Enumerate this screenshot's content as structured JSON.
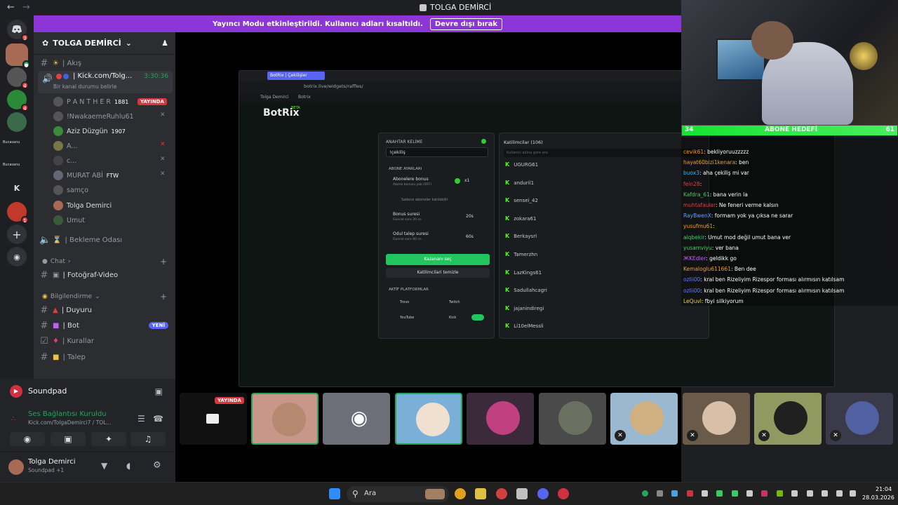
{
  "window": {
    "title": "TOLGA DEMİRCİ"
  },
  "banner": {
    "text": "Yayıncı Modu etkinleştirildi. Kullanıcı adları kısaltıldı.",
    "button": "Devre dışı bırak"
  },
  "server": {
    "name": "TOLGA DEMİRCİ"
  },
  "rail": {
    "badges": [
      "3",
      "4",
      "4",
      "1",
      "1"
    ],
    "labels": [
      "Bucasanu",
      "Bucasanu",
      "K"
    ]
  },
  "channels": {
    "akis": "| Akış",
    "voice_main": "| Kick.com/Tolg...",
    "voice_status": "Bir kanal durumu belirle",
    "voice_time": "3:30:36",
    "bekleme": "| Bekleme Odası",
    "cat_chat": "Chat",
    "foto": "| Fotoğraf-Video",
    "cat_bilgi": "Bilgilendirme",
    "duyuru": "| Duyuru",
    "bot": "| Bot",
    "kurallar": "| Kurallar",
    "talep": "| Talep",
    "live_label": "YAYINDA",
    "new_label": "YENİ"
  },
  "voice_users": [
    {
      "name": "P A N T H E R",
      "extra": "1881"
    },
    {
      "name": "!NwakaemeRuhlu61",
      "extra": ""
    },
    {
      "name": "Aziz Düzgün",
      "extra": "1907"
    },
    {
      "name": "A...",
      "extra": ""
    },
    {
      "name": "c...",
      "extra": ""
    },
    {
      "name": "MURAT ABİ",
      "extra": "FTW"
    },
    {
      "name": "samço",
      "extra": ""
    },
    {
      "name": "Tolga Demirci",
      "extra": ""
    },
    {
      "name": "Umut",
      "extra": ""
    }
  ],
  "soundpad": {
    "title": "Soundpad",
    "conn": "Ses Bağlantısı Kuruldu",
    "conn_sub": "Kick.com/TolgaDemirci7 / TOL...",
    "user": "Tolga Demirci",
    "user_sub": "Soundpad +1"
  },
  "stream": {
    "tab": "BotRix | Çekilişler",
    "url": "botrix.live/widgets/raffles/",
    "bm1": "Tolga Demirci",
    "bm2": "Botrix",
    "logo": "BotRix",
    "beta": "BETA",
    "kw_label": "ANAHTAR KELİME",
    "kw_value": "!çekiliş",
    "sub_settings": "ABONE AYARLARI",
    "sub_bonus": "Abonelere bonus",
    "sub_bonus_sub": "Abone bonusu yok (OFF)",
    "multiplier": "x1",
    "only_subs": "Sadece aboneler katılabilir",
    "dur": "Bonus suresi",
    "dur_sub": "Guncel sure 20 sn",
    "dur_val": "20s",
    "req": "Odul talep suresi",
    "req_sub": "Guncel sure 60 sn",
    "req_val": "60s",
    "pick": "Kazananı seç",
    "clear": "Katilimcilari temizle",
    "platforms": "AKTİF PLATFORMLAR",
    "p1": "Trovo",
    "p2": "Twitch",
    "p3": "YouTube",
    "p4": "Kick",
    "parts_title": "Katilimcilar (106)",
    "search_ph": "Kullanici adina gore ara",
    "participants": [
      "UGURG61",
      "anduril1",
      "sensei_42",
      "zokara61",
      "Berkaysrl",
      "Tamerzhn",
      "LazKings61",
      "Sadullahcagri",
      "jajanindiregi",
      "Li10elMessli"
    ]
  },
  "goal": {
    "left": "34",
    "label": "ABONE HEDEFİ",
    "right": "61"
  },
  "chat": [
    {
      "user": "cevik61",
      "msg": ": bekliyoruuzzzzz",
      "color": "#f0a020"
    },
    {
      "user": "hayat60bizi1kenara",
      "msg": ": ben",
      "color": "#f0a020"
    },
    {
      "user": "buox3",
      "msg": ": aha çekiliş mi var",
      "color": "#20c0f0"
    },
    {
      "user": "fein28",
      "msg": ":",
      "color": "#e04040"
    },
    {
      "user": "Kafdra_61",
      "msg": ": bana verin la",
      "color": "#40d060"
    },
    {
      "user": "muhtafaular",
      "msg": ": Ne feneri verme kalsın",
      "color": "#e04040"
    },
    {
      "user": "RayBwenX",
      "msg": ": formam yok ya çıksa ne sarar",
      "color": "#60a0ff"
    },
    {
      "user": "yusufmu61",
      "msg": ":",
      "color": "#f0a020"
    },
    {
      "user": "alqbekir",
      "msg": ": Umut mod değil umut bana ver",
      "color": "#40d060"
    },
    {
      "user": "yusamviyu",
      "msg": ": ver bana",
      "color": "#40d060"
    },
    {
      "user": "ЖKEdler",
      "msg": ": geldikk go",
      "color": "#c060f0"
    },
    {
      "user": "Kemaloglu611661",
      "msg": ": Ben dee",
      "color": "#f0a020"
    },
    {
      "user": "ozlii00",
      "msg": ": kral ben Rizeliyim Rizespor forması alırmısın katılsam",
      "color": "#6080ff"
    },
    {
      "user": "ozlii00",
      "msg": ": kral ben Rizeliyim Rizespor forması alırmısın katılsam",
      "color": "#6080ff"
    },
    {
      "user": "LeQuvl",
      "msg": ": fbyi silkiyorum",
      "color": "#f0d020"
    }
  ],
  "tiles_live": "YAYINDA",
  "taskbar": {
    "search": "Ara",
    "time": "21:04",
    "date": "28.03.2026"
  },
  "colors": {
    "accent": "#5865f2",
    "banner": "#8c36d8",
    "kick": "#53fc18",
    "live": "#da373c"
  }
}
